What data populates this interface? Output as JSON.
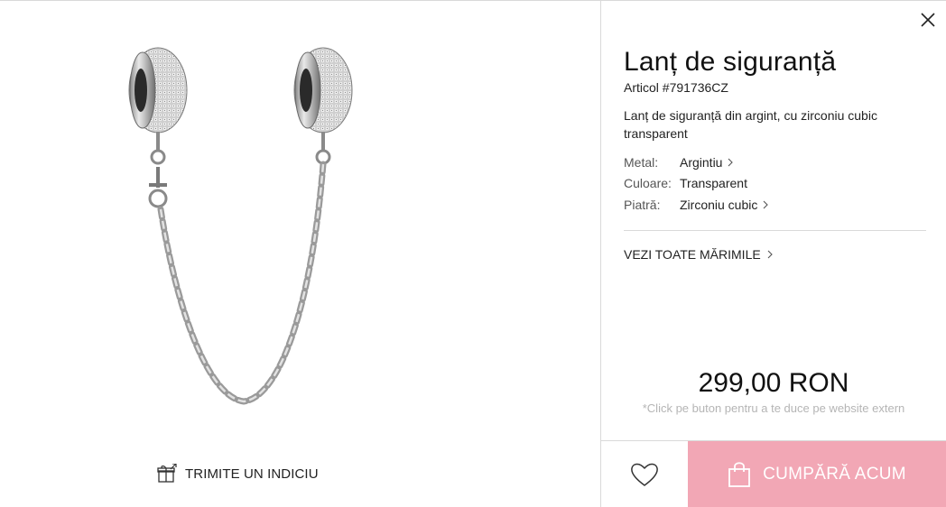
{
  "product": {
    "title": "Lanț de siguranță",
    "sku": "Articol #791736CZ",
    "description": "Lanț de siguranță din argint, cu zirconiu cubic transparent",
    "attributes": [
      {
        "key": "Metal:",
        "value": "Argintiu",
        "has_link": true
      },
      {
        "key": "Culoare:",
        "value": "Transparent",
        "has_link": false
      },
      {
        "key": "Piatră:",
        "value": "Zirconiu cubic",
        "has_link": true
      }
    ],
    "sizes_link": "VEZI TOATE MĂRIMILE",
    "price": "299,00 RON",
    "note": "*Click pe buton pentru a te duce pe website extern"
  },
  "actions": {
    "hint_label": "TRIMITE UN INDICIU",
    "buy_label": "CUMPĂRĂ ACUM"
  },
  "icons": {
    "close": "close-icon",
    "gift": "gift-icon",
    "heart": "heart-icon",
    "bag": "shopping-bag-icon",
    "chevron": "chevron-right-icon"
  },
  "colors": {
    "buy_button": "#f2a7b5",
    "border": "#d9d9d9",
    "note_text": "#b5b5b5"
  }
}
